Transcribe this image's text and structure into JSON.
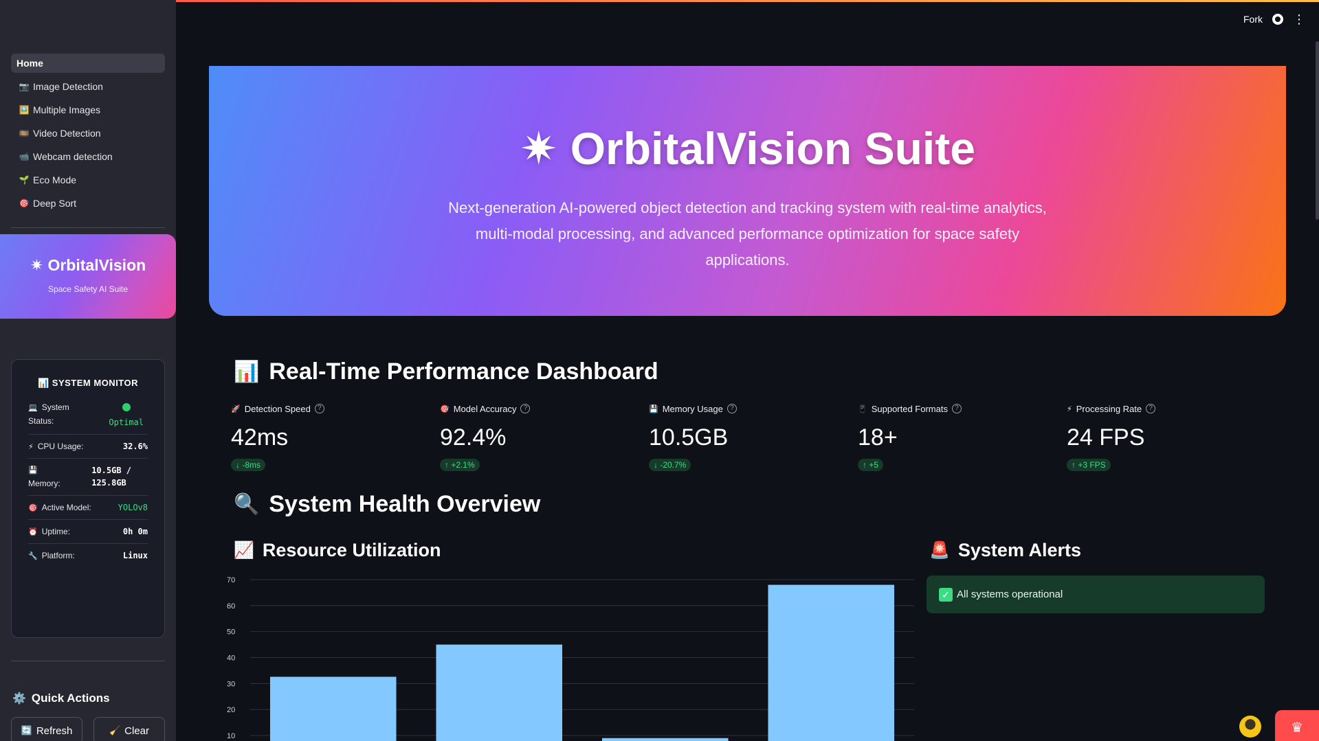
{
  "header": {
    "fork_label": "Fork",
    "icons": [
      "github-icon",
      "kebab-menu-icon"
    ]
  },
  "sidebar": {
    "nav": [
      {
        "label": "Home",
        "icon": "",
        "active": true
      },
      {
        "label": "Image Detection",
        "icon": "📷"
      },
      {
        "label": "Multiple Images",
        "icon": "🖼️"
      },
      {
        "label": "Video Detection",
        "icon": "🎞️"
      },
      {
        "label": "Webcam detection",
        "icon": "📹"
      },
      {
        "label": "Eco Mode",
        "icon": "🌱"
      },
      {
        "label": "Deep Sort",
        "icon": "🎯"
      }
    ],
    "brand": {
      "title": "✷ OrbitalVision",
      "subtitle": "Space Safety AI Suite"
    },
    "monitor": {
      "title": "SYSTEM MONITOR",
      "title_icon": "📊",
      "system_label": "System",
      "status_label": "Status:",
      "status_value": "Optimal",
      "cpu_label": "CPU Usage:",
      "cpu_value": "32.6%",
      "memory_label": "Memory:",
      "memory_value_1": "10.5GB /",
      "memory_value_2": "125.8GB",
      "model_label": "Active Model:",
      "model_value": "YOLOv8",
      "uptime_label": "Uptime:",
      "uptime_value": "0h 0m",
      "platform_label": "Platform:",
      "platform_value": "Linux"
    },
    "quick_actions": {
      "title": "Quick Actions",
      "refresh": "Refresh",
      "clear": "Clear"
    }
  },
  "hero": {
    "title": "✷ OrbitalVision Suite",
    "description": "Next-generation AI-powered object detection and tracking system with real-time analytics, multi-modal processing, and advanced performance optimization for space safety applications."
  },
  "dashboard": {
    "title": "Real-Time Performance Dashboard",
    "title_icon": "📊",
    "metrics": [
      {
        "icon": "🚀",
        "label": "Detection Speed",
        "value": "42ms",
        "delta": "↓ -8ms"
      },
      {
        "icon": "🎯",
        "label": "Model Accuracy",
        "value": "92.4%",
        "delta": "↑ +2.1%"
      },
      {
        "icon": "💾",
        "label": "Memory Usage",
        "value": "10.5GB",
        "delta": "↓ -20.7%"
      },
      {
        "icon": "📱",
        "label": "Supported Formats",
        "value": "18+",
        "delta": "↑ +5"
      },
      {
        "icon": "⚡",
        "label": "Processing Rate",
        "value": "24 FPS",
        "delta": "↑ +3 FPS"
      }
    ]
  },
  "health": {
    "title": "System Health Overview",
    "title_icon": "🔍",
    "resource_title": "Resource Utilization",
    "resource_icon": "📈",
    "alerts_title": "System Alerts",
    "alerts_icon": "🚨",
    "alert_message": "All systems operational"
  },
  "chart_data": {
    "type": "bar",
    "values": [
      32.6,
      45,
      9,
      68
    ],
    "yticks": [
      10,
      20,
      30,
      40,
      50,
      60,
      70
    ],
    "bar_color": "#83c9ff",
    "grid": true
  }
}
